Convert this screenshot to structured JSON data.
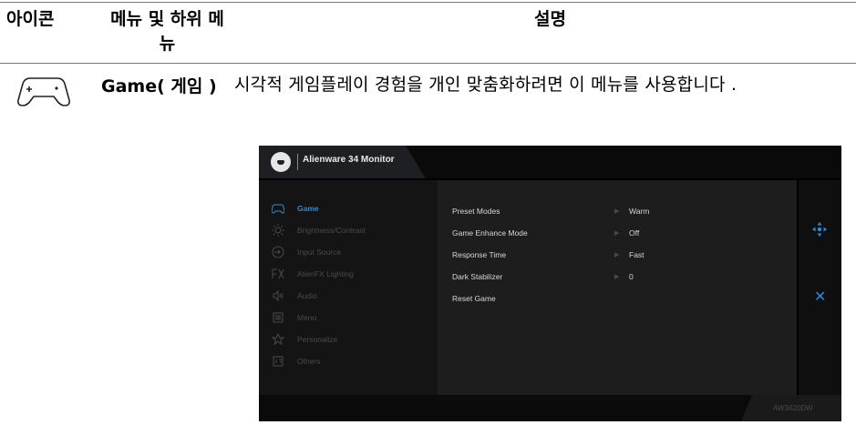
{
  "table": {
    "headers": {
      "icon": "아이콘",
      "menu": "메뉴 및 하위 메뉴",
      "description": "설명"
    },
    "row": {
      "icon": "gamepad-icon",
      "name": "Game( 게임 )",
      "description": "시각적 게임플레이 경험을 개인 맞춤화하려면 이 메뉴를 사용합니다 ."
    }
  },
  "osd": {
    "title": "Alienware 34 Monitor",
    "model": "AW3420DW",
    "accent_color": "#2a8cdb",
    "menu": [
      {
        "label": "Game",
        "icon": "gamepad-icon",
        "active": true
      },
      {
        "label": "Brightness/Contrast",
        "icon": "brightness-icon",
        "active": false
      },
      {
        "label": "Input Source",
        "icon": "input-source-icon",
        "active": false
      },
      {
        "label": "AlienFX Lighting",
        "icon": "fx-icon",
        "active": false
      },
      {
        "label": "Audio",
        "icon": "speaker-icon",
        "active": false
      },
      {
        "label": "Menu",
        "icon": "menu-icon",
        "active": false
      },
      {
        "label": "Personalize",
        "icon": "star-icon",
        "active": false
      },
      {
        "label": "Others",
        "icon": "others-icon",
        "active": false
      }
    ],
    "settings": [
      {
        "name": "Preset Modes",
        "value": "Warm"
      },
      {
        "name": "Game Enhance Mode",
        "value": "Off"
      },
      {
        "name": "Response Time",
        "value": "Fast"
      },
      {
        "name": "Dark Stabilizer",
        "value": "0"
      },
      {
        "name": "Reset Game",
        "value": ""
      }
    ]
  }
}
